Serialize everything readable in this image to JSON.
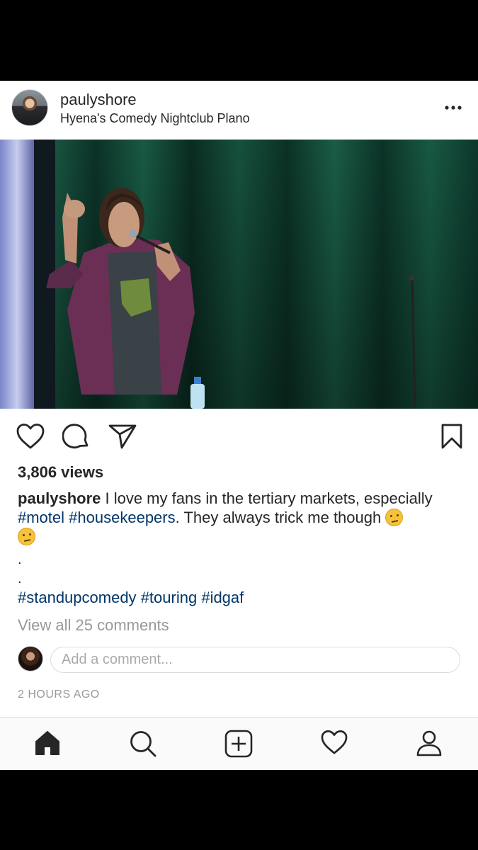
{
  "post": {
    "username": "paulyshore",
    "location": "Hyena's Comedy Nightclub Plano",
    "views": "3,806 views",
    "caption": {
      "username": "paulyshore",
      "text_part1": " I love my fans in the tertiary markets, especially ",
      "tag1": "#motel",
      "tag2": "#housekeepers",
      "text_part2": ". They always trick me though ",
      "dot1": ".",
      "dot2": "."
    },
    "hashtags": [
      "#standupcomedy",
      "#touring",
      "#idgaf"
    ],
    "view_all_comments": "View all 25 comments",
    "comment_placeholder": "Add a comment...",
    "timestamp": "2 HOURS AGO"
  },
  "icons": {
    "more": "more-horizontal-icon",
    "like": "heart-icon",
    "comment": "comment-icon",
    "share": "paper-plane-icon",
    "save": "bookmark-icon",
    "emoji": "thinking-face-emoji",
    "nav": [
      "home-icon",
      "search-icon",
      "add-post-icon",
      "activity-heart-icon",
      "profile-icon"
    ]
  },
  "colors": {
    "hashtag": "#003569",
    "muted": "#999999",
    "text": "#262626"
  }
}
